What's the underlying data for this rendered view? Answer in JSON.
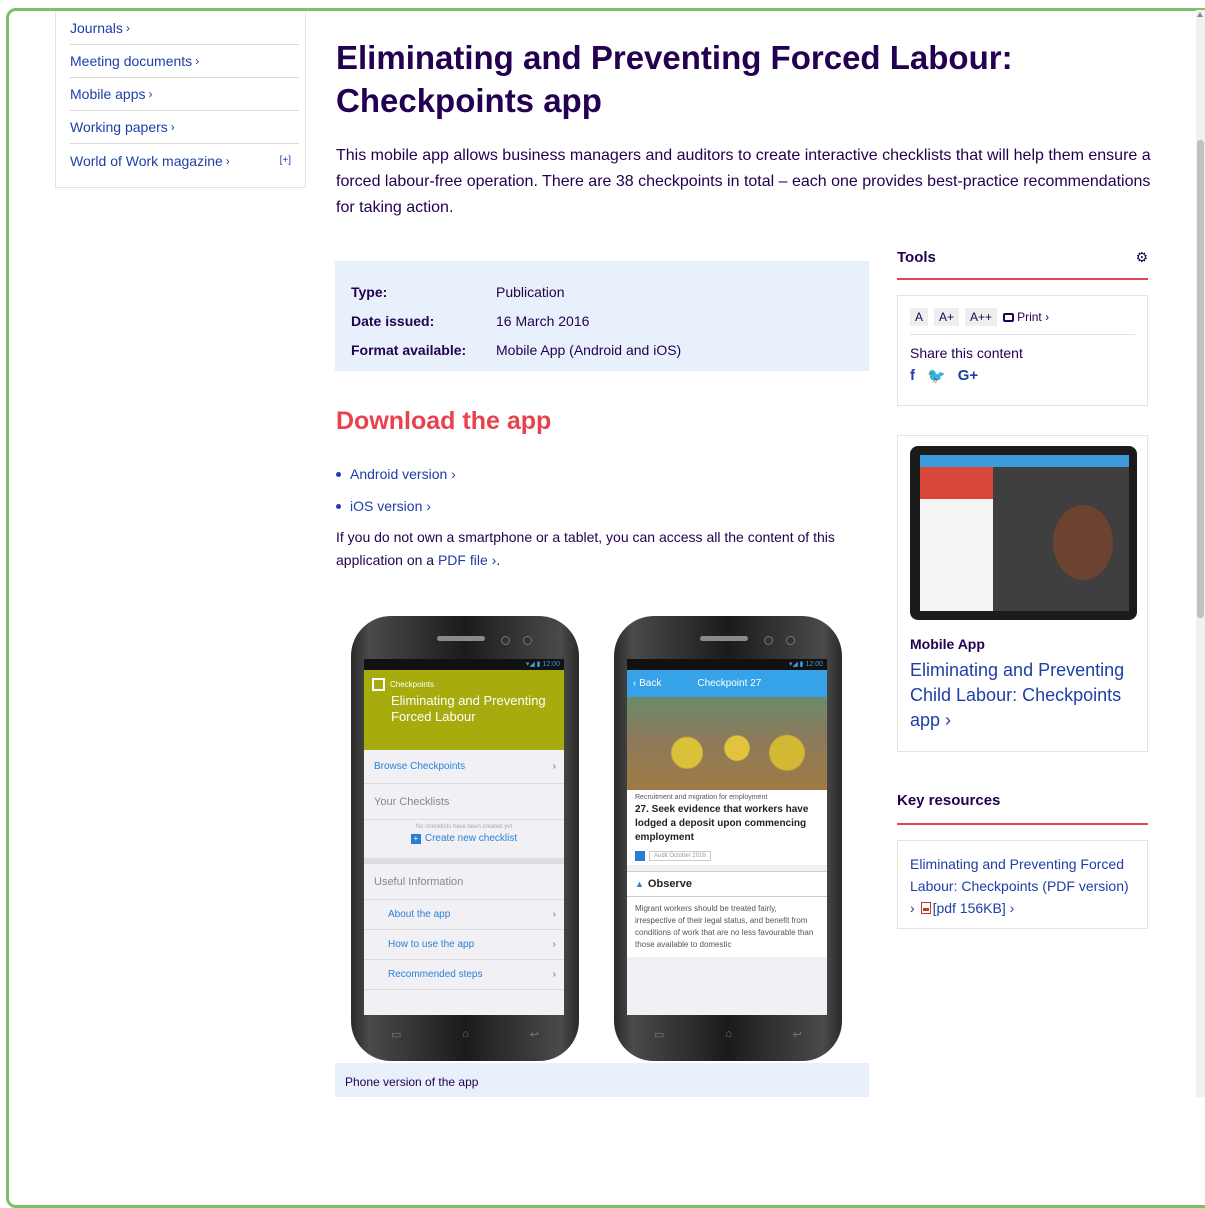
{
  "left_nav": {
    "items": [
      {
        "label": "Journals"
      },
      {
        "label": "Meeting documents"
      },
      {
        "label": "Mobile apps"
      },
      {
        "label": "Working papers"
      },
      {
        "label": "World of Work magazine",
        "expander": "[+]"
      }
    ],
    "chevron": "›"
  },
  "page": {
    "title": "Eliminating and Preventing Forced Labour: Checkpoints app",
    "intro": "This mobile app allows business managers and auditors to create interactive checklists that will help them ensure a forced labour-free operation. There are 38 checkpoints in total – each one provides best-practice recommendations for taking action."
  },
  "meta": {
    "rows": [
      {
        "key": "Type:",
        "value": "Publication"
      },
      {
        "key": "Date issued:",
        "value": "16 March 2016"
      },
      {
        "key": "Format available:",
        "value": "Mobile App (Android and iOS)"
      }
    ]
  },
  "download": {
    "heading": "Download the app",
    "links": [
      {
        "label": "Android version ›"
      },
      {
        "label": "iOS version ›"
      }
    ],
    "note_before": "If you do not own a smartphone or a tablet, you can access all the content of this application on a ",
    "note_link": "PDF file ›",
    "note_after": "."
  },
  "figure": {
    "caption": "Phone version of the app",
    "phone1": {
      "status": "▾◢ ▮ 12:00",
      "small": "Checkpoints",
      "big": "Eliminating and Preventing Forced Labour",
      "browse": "Browse Checkpoints",
      "your_checklists": "Your Checklists",
      "no_checklists": "No checklists have been created yet",
      "create": "Create new checklist",
      "useful": "Useful Information",
      "about": "About the app",
      "howto": "How to use the app",
      "recommended": "Recommended steps"
    },
    "phone2": {
      "status": "▾◢ ▮ 12:00",
      "back": "Back",
      "title": "Checkpoint 27",
      "category": "Recruitment and migration for employment",
      "checkpoint": "27. Seek evidence that workers have lodged a deposit upon commencing employment",
      "tag": "Audit October 2016",
      "observe": "Observe",
      "para": "Migrant workers should be treated fairly, irrespective of their legal status, and benefit from conditions of work that are no less favourable than those available to domestic"
    }
  },
  "tools": {
    "heading": "Tools",
    "sizes": [
      "A",
      "A+",
      "A++"
    ],
    "print": "Print ›",
    "share_label": "Share this content",
    "share_icons": [
      "f",
      "🐦",
      "G+"
    ]
  },
  "app_card": {
    "label": "Mobile App",
    "link": "Eliminating and Preventing Child Labour: Checkpoints app ›"
  },
  "key_resources": {
    "heading": "Key resources",
    "link_text": "Eliminating and Preventing Forced Labour: Checkpoints (PDF version) ›",
    "file_text": "[pdf 156KB] ›"
  },
  "colors": {
    "title": "#230050",
    "link": "#1e3ea8",
    "accent_red": "#e8424f",
    "meta_bg": "#e8f1fb",
    "frame_green": "#7dbf6a"
  }
}
